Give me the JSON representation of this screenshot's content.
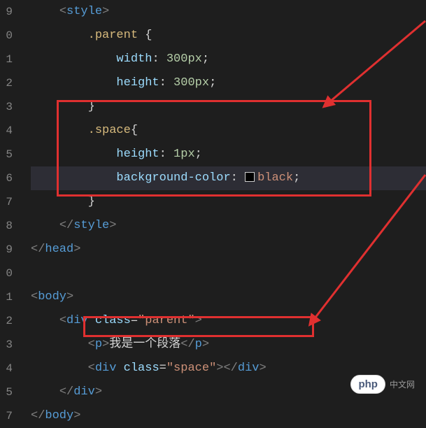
{
  "lines": {
    "l0": {
      "num": "9"
    },
    "l1": {
      "num": "0"
    },
    "l2": {
      "num": "1"
    },
    "l3": {
      "num": "2"
    },
    "l4": {
      "num": "3"
    },
    "l5": {
      "num": "4"
    },
    "l6": {
      "num": "5"
    },
    "l7": {
      "num": "6"
    },
    "l8": {
      "num": "7"
    },
    "l9": {
      "num": "8"
    },
    "l10": {
      "num": "9"
    },
    "l11": {
      "num": "0"
    },
    "l12": {
      "num": "1"
    },
    "l13": {
      "num": "2"
    },
    "l14": {
      "num": "3"
    },
    "l15": {
      "num": "4"
    },
    "l16": {
      "num": "5"
    },
    "l17": {
      "num": "7"
    }
  },
  "code": {
    "style_open": "style",
    "style_close": "style",
    "head_close": "head",
    "body_open": "body",
    "body_close": "body",
    "div_open_tag": "div",
    "div_close_tag": "div",
    "p_tag": "p",
    "p_close": "p",
    "class_attr": "class",
    "parent_sel": ".parent",
    "space_sel": ".space",
    "width_prop": "width",
    "height_prop": "height",
    "bgcolor_prop": "background-color",
    "val_300px": "300px",
    "val_1px": "1px",
    "val_black": "black",
    "str_parent": "\"parent\"",
    "str_space": "\"space\"",
    "p_text": "我是一个段落",
    "brace_open": " {",
    "brace_open2": "{",
    "brace_close": "}",
    "lt": "<",
    "gt": ">",
    "lts": "</",
    "colon": ":",
    "semi": ";",
    "eq": "="
  },
  "watermark": {
    "logo": "php",
    "text": "中文网"
  }
}
